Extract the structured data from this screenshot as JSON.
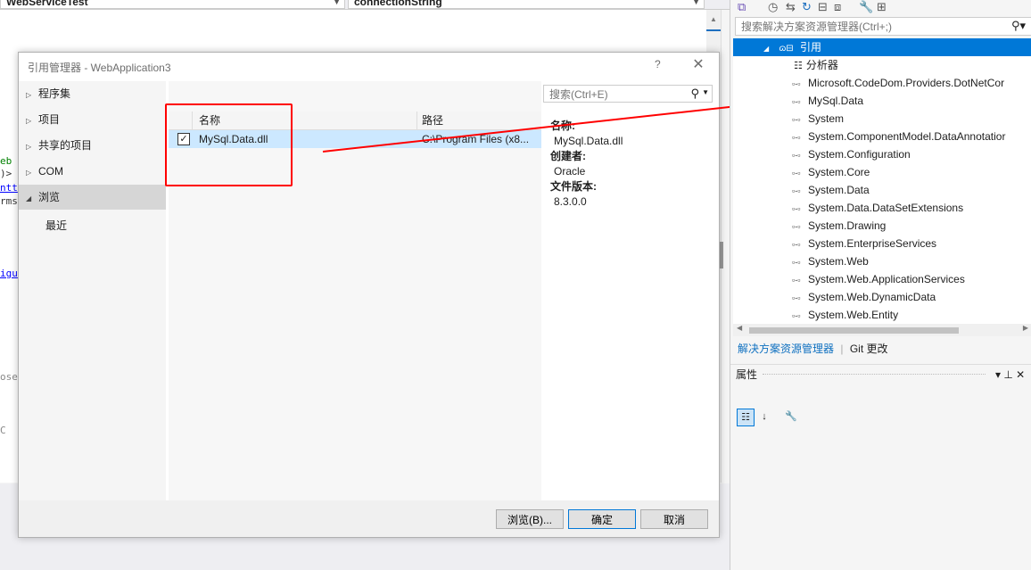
{
  "vs": {
    "combo1": "WebServiceTest",
    "combo2": "connectionString",
    "code_fragments": [
      "eb",
      ")> ]",
      "ntt",
      "rms",
      "igu",
      "ose",
      "C"
    ]
  },
  "dialog": {
    "title": "引用管理器 - WebApplication3",
    "help": "?",
    "close": "✕",
    "nav": [
      {
        "label": "程序集",
        "expander": "▷"
      },
      {
        "label": "项目",
        "expander": "▷"
      },
      {
        "label": "共享的项目",
        "expander": "▷"
      },
      {
        "label": "COM",
        "expander": "▷"
      },
      {
        "label": "浏览",
        "expander": "◢"
      },
      {
        "label": "最近",
        "expander": ""
      }
    ],
    "search_placeholder": "搜索(Ctrl+E)",
    "columns": {
      "name": "名称",
      "path": "路径"
    },
    "rows": [
      {
        "checked": "✓",
        "name": "MySql.Data.dll",
        "path": "C:\\Program Files (x8..."
      }
    ],
    "details": {
      "name_label": "名称:",
      "name_value": "MySql.Data.dll",
      "creator_label": "创建者:",
      "creator_value": "Oracle",
      "version_label": "文件版本:",
      "version_value": "8.3.0.0"
    },
    "buttons": {
      "browse": "浏览(B)...",
      "ok": "确定",
      "cancel": "取消"
    }
  },
  "solution_explorer": {
    "search_placeholder": "搜索解决方案资源管理器(Ctrl+;)",
    "references_node": {
      "expander": "◢",
      "label": "引用"
    },
    "analyzer": "分析器",
    "references": [
      "Microsoft.CodeDom.Providers.DotNetCor",
      "MySql.Data",
      "System",
      "System.ComponentModel.DataAnnotatior",
      "System.Configuration",
      "System.Core",
      "System.Data",
      "System.Data.DataSetExtensions",
      "System.Drawing",
      "System.EnterpriseServices",
      "System.Web",
      "System.Web.ApplicationServices",
      "System.Web.DynamicData",
      "System.Web.Entity"
    ],
    "tabs": {
      "active": "解决方案资源管理器",
      "inactive": "Git 更改"
    },
    "properties": {
      "title": "属性",
      "pin": "▾ ⊥ ✕"
    }
  },
  "colors": {
    "annotation_red": "#ff0000",
    "selection_blue": "#0078d7",
    "row_highlight": "#cce8ff",
    "link_blue": "#0e70c0"
  }
}
